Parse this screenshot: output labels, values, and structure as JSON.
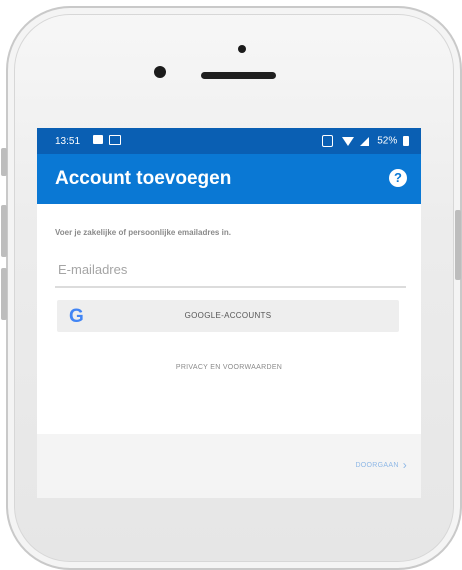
{
  "status_bar": {
    "time": "13:51",
    "battery": "52%"
  },
  "app_bar": {
    "title": "Account toevoegen",
    "help_icon": "?"
  },
  "form": {
    "prompt": "Voer je zakelijke of persoonlijke emailadres in.",
    "email_placeholder": "E-mailadres",
    "email_value": ""
  },
  "google_button": {
    "logo": "G",
    "label": "GOOGLE-ACCOUNTS"
  },
  "privacy_link": "PRIVACY EN VOORWAARDEN",
  "footer": {
    "next_label": "DOORGAAN",
    "next_icon": "›"
  },
  "colors": {
    "status_bar": "#0a5fb3",
    "app_bar": "#0a78d4",
    "next_disabled": "#8fb8e6"
  }
}
